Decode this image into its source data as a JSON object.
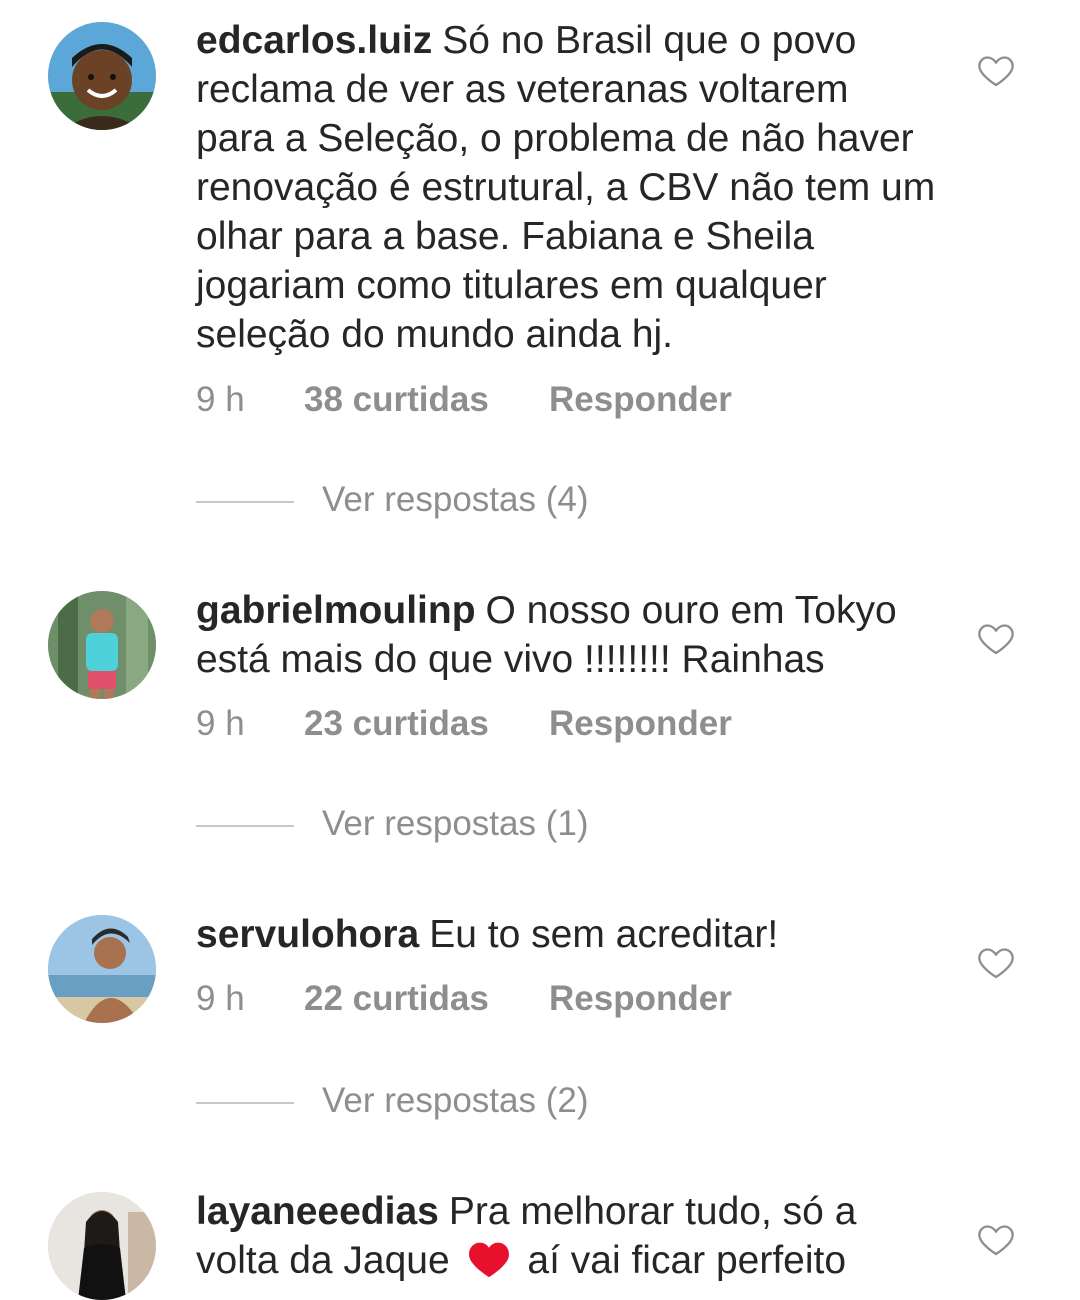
{
  "comments": [
    {
      "username": "edcarlos.luiz",
      "text": "Só no Brasil que o povo reclama de ver as veteranas voltarem para a Seleção, o problema de não haver renovação é estrutural, a CBV não tem um olhar para a base. Fabiana e Sheila jogariam como titulares em qualquer seleção do mundo ainda hj.",
      "time": "9 h",
      "likes": "38 curtidas",
      "reply": "Responder",
      "view_replies": "Ver respostas (4)",
      "avatar_icon": "profile-photo"
    },
    {
      "username": "gabrielmoulinp",
      "text": "O nosso ouro em Tokyo está mais do que vivo !!!!!!!! Rainhas",
      "time": "9 h",
      "likes": "23 curtidas",
      "reply": "Responder",
      "view_replies": "Ver respostas (1)",
      "avatar_icon": "profile-photo"
    },
    {
      "username": "servulohora",
      "text": "Eu to sem acreditar!",
      "time": "9 h",
      "likes": "22 curtidas",
      "reply": "Responder",
      "view_replies": "Ver respostas (2)",
      "avatar_icon": "profile-photo"
    },
    {
      "username": "layaneeedias",
      "text_before_emoji": "Pra melhorar tudo, só a volta da Jaque",
      "emoji": "red-heart-emoji",
      "text_after_emoji": "aí vai ficar perfeito",
      "avatar_icon": "profile-photo"
    }
  ],
  "colors": {
    "text": "#262626",
    "secondary": "#8e8e8e",
    "divider": "#c7c7c7",
    "heart_emoji": "#e8112d"
  }
}
